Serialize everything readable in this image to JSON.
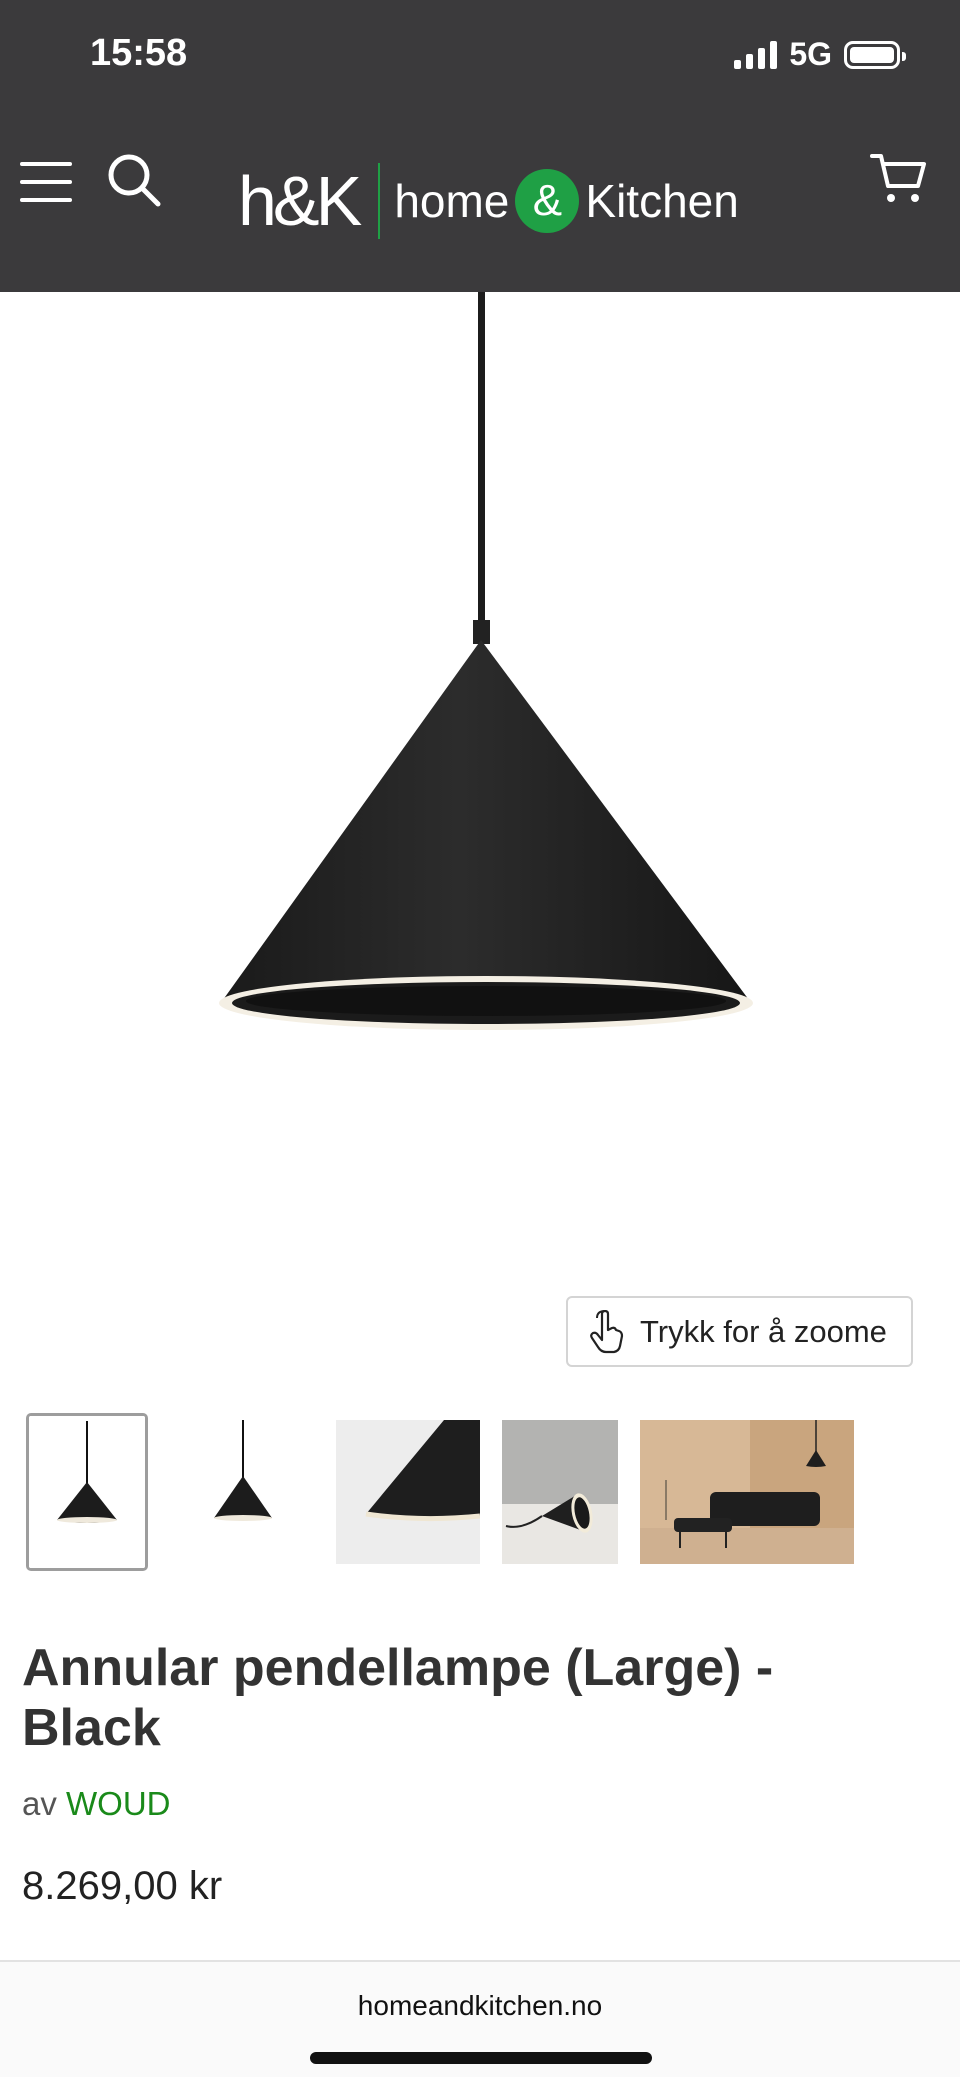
{
  "status": {
    "time": "15:58",
    "network": "5G"
  },
  "header": {
    "logo_short": "h&K",
    "logo_name_left": "home",
    "logo_amp": "&",
    "logo_name_right": "Kitchen"
  },
  "gallery": {
    "zoom_label": "Trykk for å zoome",
    "thumbnails": [
      "pendant-front",
      "pendant-side",
      "cone-closeup",
      "lamp-on-floor",
      "living-room-scene"
    ]
  },
  "product": {
    "title": "Annular pendellampe (Large) - Black",
    "by_prefix": "av",
    "brand": "WOUD",
    "price": "8.269,00 kr"
  },
  "browser": {
    "url": "homeandkitchen.no"
  },
  "colors": {
    "header_bg": "#3b3a3c",
    "brand_green": "#1fa045",
    "brand_link": "#1a8a1a"
  }
}
